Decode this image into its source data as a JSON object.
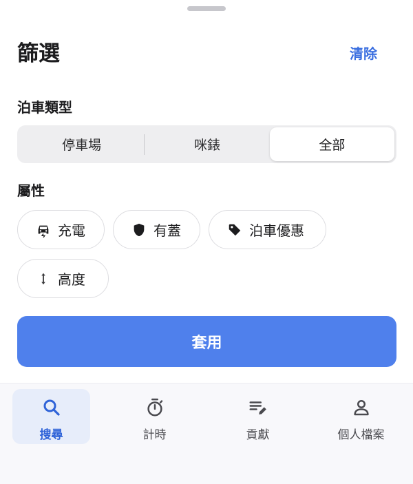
{
  "sheet": {
    "title": "篩選",
    "clear_label": "清除"
  },
  "parking_type": {
    "label": "泊車類型",
    "options": [
      "停車場",
      "咪錶",
      "全部"
    ],
    "selected": "全部"
  },
  "attributes": {
    "label": "屬性",
    "chips": [
      {
        "label": "充電",
        "icon": "ev-car-icon"
      },
      {
        "label": "有蓋",
        "icon": "shield-icon"
      },
      {
        "label": "泊車優惠",
        "icon": "tag-icon"
      },
      {
        "label": "高度",
        "icon": "height-arrows-icon"
      }
    ]
  },
  "apply_label": "套用",
  "tabbar": {
    "tabs": [
      {
        "label": "搜尋",
        "icon": "search-icon",
        "active": true
      },
      {
        "label": "計時",
        "icon": "timer-icon",
        "active": false
      },
      {
        "label": "貢獻",
        "icon": "edit-list-icon",
        "active": false
      },
      {
        "label": "個人檔案",
        "icon": "person-icon",
        "active": false
      }
    ]
  },
  "colors": {
    "accent": "#4f80ec",
    "link": "#3b6fe0",
    "active_tab_bg": "#e7edfa"
  }
}
